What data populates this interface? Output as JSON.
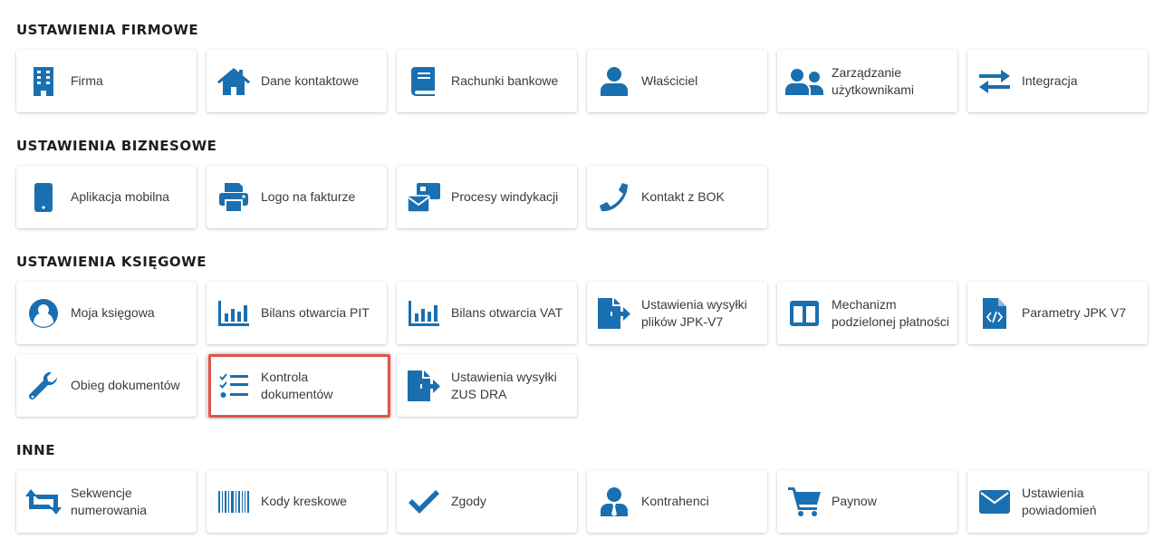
{
  "sections": {
    "firmowe": {
      "title": "USTAWIENIA FIRMOWE",
      "items": [
        {
          "label": "Firma",
          "icon": "building-icon"
        },
        {
          "label": "Dane kontaktowe",
          "icon": "home-icon"
        },
        {
          "label": "Rachunki bankowe",
          "icon": "book-icon"
        },
        {
          "label": "Właściciel",
          "icon": "user-icon"
        },
        {
          "label": "Zarządzanie użytkownikami",
          "icon": "users-icon"
        },
        {
          "label": "Integracja",
          "icon": "exchange-arrows-icon"
        }
      ]
    },
    "biznesowe": {
      "title": "USTAWIENIA BIZNESOWE",
      "items": [
        {
          "label": "Aplikacja mobilna",
          "icon": "mobile-phone-icon"
        },
        {
          "label": "Logo na fakturze",
          "icon": "printer-icon"
        },
        {
          "label": "Procesy windykacji",
          "icon": "mail-bulk-icon"
        },
        {
          "label": "Kontakt z BOK",
          "icon": "phone-icon"
        }
      ]
    },
    "ksiegowe": {
      "title": "USTAWIENIA KSIĘGOWE",
      "items": [
        {
          "label": "Moja księgowa",
          "icon": "user-circle-icon"
        },
        {
          "label": "Bilans otwarcia PIT",
          "icon": "bar-chart-icon"
        },
        {
          "label": "Bilans otwarcia VAT",
          "icon": "bar-chart-icon"
        },
        {
          "label": "Ustawienia wysyłki plików JPK-V7",
          "icon": "file-export-icon"
        },
        {
          "label": "Mechanizm podzielonej płatności",
          "icon": "columns-icon"
        },
        {
          "label": "Parametry JPK V7",
          "icon": "file-code-icon"
        },
        {
          "label": "Obieg dokumentów",
          "icon": "wrench-icon"
        },
        {
          "label": "Kontrola dokumentów",
          "icon": "checklist-icon"
        },
        {
          "label": "Ustawienia wysyłki ZUS DRA",
          "icon": "file-export-icon"
        }
      ]
    },
    "inne": {
      "title": "INNE",
      "items": [
        {
          "label": "Sekwencje numerowania",
          "icon": "retweet-icon"
        },
        {
          "label": "Kody kreskowe",
          "icon": "barcode-icon"
        },
        {
          "label": "Zgody",
          "icon": "check-icon"
        },
        {
          "label": "Kontrahenci",
          "icon": "user-tie-icon"
        },
        {
          "label": "Paynow",
          "icon": "shopping-cart-icon"
        },
        {
          "label": "Ustawienia powiadomień",
          "icon": "envelope-icon"
        }
      ]
    }
  },
  "colors": {
    "accent": "#1a6fb0",
    "highlight": "#e2544a"
  }
}
